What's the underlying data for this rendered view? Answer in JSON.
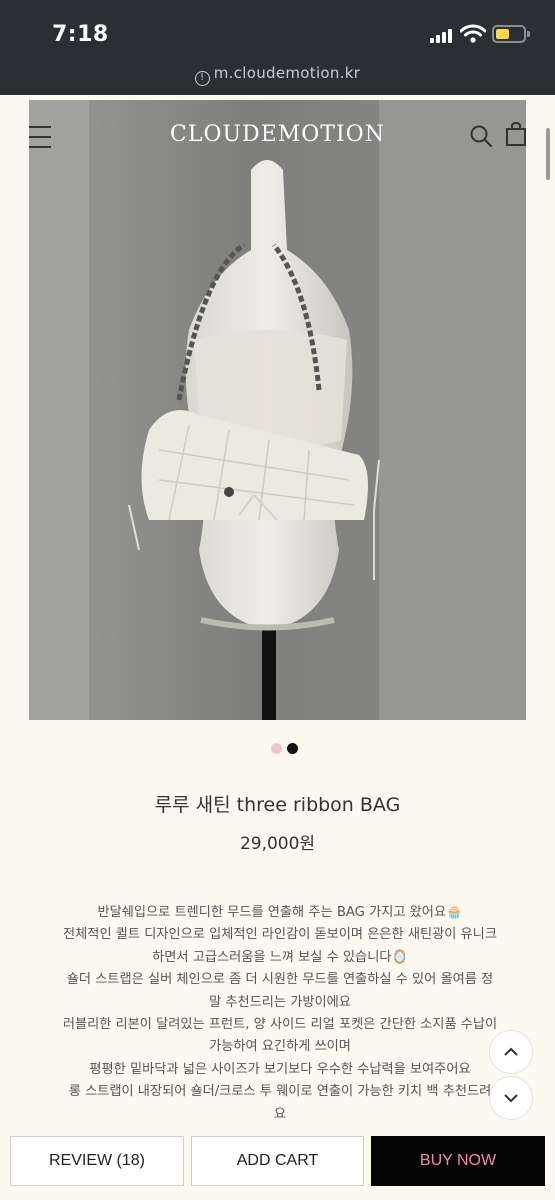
{
  "status_bar": {
    "time": "7:18",
    "battery_level": 0.5,
    "battery_color": "#f5d94a"
  },
  "browser": {
    "url": "m.cloudemotion.kr"
  },
  "site_header": {
    "logo": "CLOUDEMOTION"
  },
  "gallery": {
    "current_index": 2,
    "total": 2,
    "active_color": "#111111",
    "inactive_color": "#f0c4cc"
  },
  "product": {
    "title": "루루 새틴 three ribbon BAG",
    "price": "29,000원",
    "description": [
      "반달쉐입으로 트렌디한 무드를 연출해 주는 BAG 가지고 왔어요🧁",
      "전체적인 퀼트 디자인으로 입체적인 라인감이 돋보이며 은은한 새틴광이 유니크",
      "하면서 고급스러움을 느껴 보실 수 있습니다🪞",
      "숄더 스트랩은 실버 체인으로 좀 더 시원한 무드를 연출하실 수 있어 올여름 정",
      "말 추천드리는 가방이에요",
      "러블리한 리본이 달려있는 프런트, 양 사이드 리얼 포켓은 간단한 소지품 수납이",
      "가능하여 요긴하게 쓰이며",
      "평평한 밑바닥과 넓은 사이즈가 보기보다 우수한 수납력을 보여주어요",
      "롱 스트랩이 내장되어 숄더/크로스 투 웨이로 연출이 가능한 키치 백 추천드려",
      "요"
    ]
  },
  "actions": {
    "review": "REVIEW (18)",
    "add_cart": "ADD CART",
    "buy_now": "BUY NOW",
    "buy_now_color": "#f08aa8"
  }
}
